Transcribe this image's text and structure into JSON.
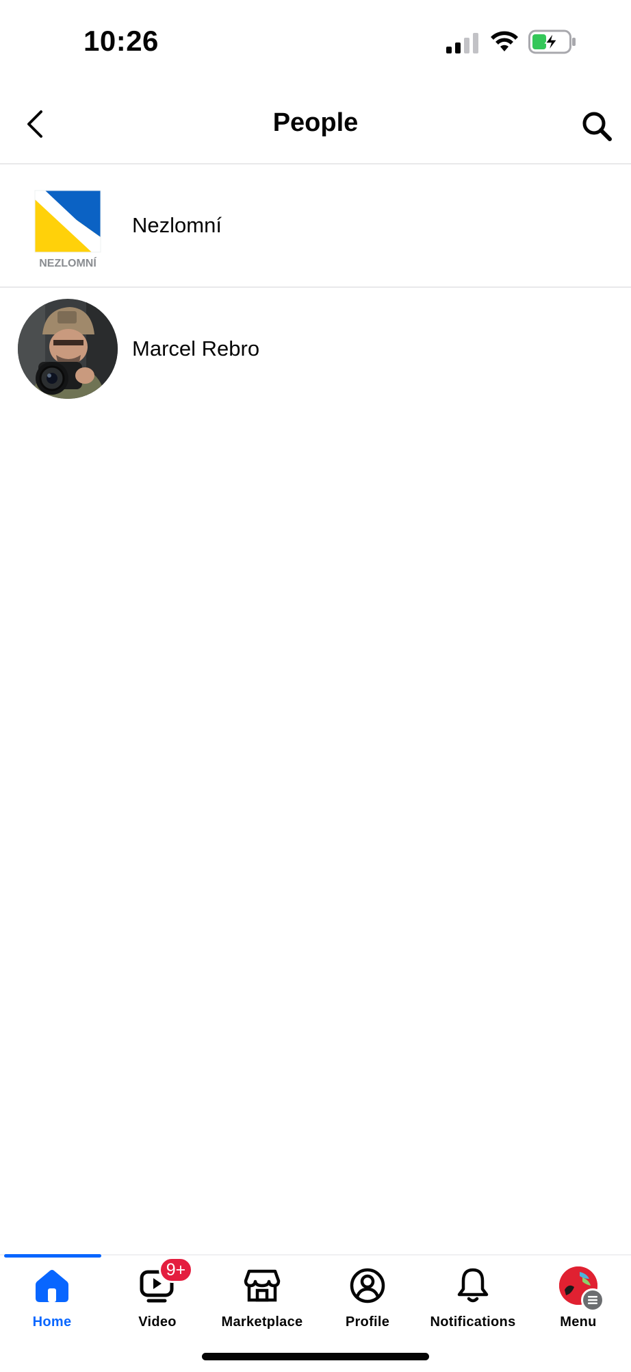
{
  "status_bar": {
    "time": "10:26"
  },
  "header": {
    "title": "People",
    "back_icon": "chevron-left-icon",
    "search_icon": "search-icon"
  },
  "people": [
    {
      "name": "Nezlomní",
      "logo_text": "NEZLOMNÍ",
      "avatar": "nezlomni-logo"
    },
    {
      "name": "Marcel Rebro",
      "avatar": "profile-photo"
    }
  ],
  "tab_bar": {
    "tabs": [
      {
        "label": "Home",
        "icon": "home-icon",
        "active": true
      },
      {
        "label": "Video",
        "icon": "video-icon",
        "badge": "9+"
      },
      {
        "label": "Marketplace",
        "icon": "marketplace-icon"
      },
      {
        "label": "Profile",
        "icon": "profile-icon"
      },
      {
        "label": "Notifications",
        "icon": "bell-icon"
      },
      {
        "label": "Menu",
        "icon": "menu-avatar-icon"
      }
    ]
  },
  "colors": {
    "accent": "#0866ff",
    "badge": "#e41e3f",
    "text": "#050505",
    "divider": "#e8e8ea",
    "battery_green": "#34c759",
    "logo_blue": "#0b62c4",
    "logo_yellow": "#ffd10a"
  }
}
